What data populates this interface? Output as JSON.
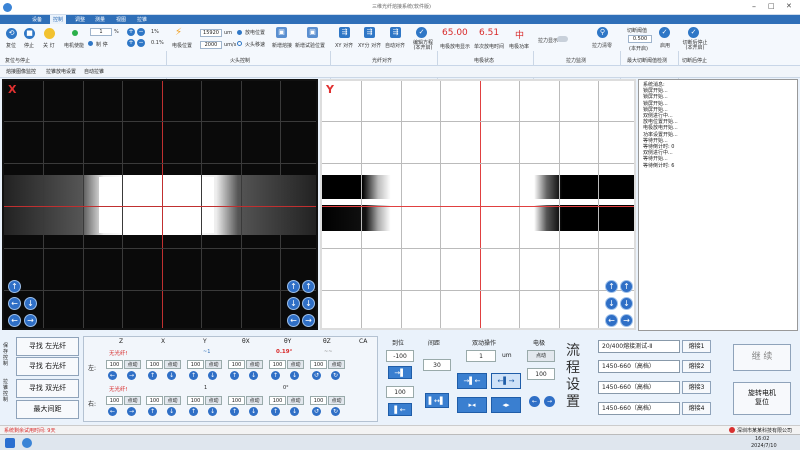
{
  "app": {
    "title": "三维光纤熔接系统(软件版)"
  },
  "menu": {
    "items": [
      "设备",
      "控制",
      "调整",
      "测量",
      "视图",
      "拉锥"
    ],
    "active_index": 1
  },
  "ribbon": {
    "reset_label": "复位",
    "stop_label": "停止",
    "on_label": "关 灯",
    "motor_label": "电机使能",
    "brake_label": "制 停",
    "step_value": "1",
    "step_unit": "%",
    "speed1": "1%",
    "speed2": "0.1%",
    "fire_pos_label": "电极位置",
    "motor_pos": "15920",
    "motor_unit1": "um",
    "fire_pos": "2000",
    "motor_unit2": "um/s",
    "electrode_pos_label": "放电位置",
    "fire_move_label": "火头移速",
    "new_fiber_label": "新增熔接",
    "new_trial_label": "新增试验位置",
    "group1": "复位与停止",
    "group2": "火头控制",
    "xy_align": "XY 对齐",
    "xy_focus": "XY分 对齐",
    "auto_align": "自动对齐",
    "edit_program": "编辑方程\n(本开启)",
    "group3": "光纤对齐",
    "param1": "65.00",
    "param2": "6.51",
    "param3": "中",
    "param1_label": "电极放电显示",
    "param2_label": "单次放电时间",
    "param3_label": "电极功率",
    "group4": "电极状态",
    "tension_label": "拉力显示",
    "tension_clear": "拉力清零",
    "group5": "拉力监测",
    "max_force_label": "切断阈值",
    "max_force_value": "0.500",
    "max_force_note": "(本开启)",
    "apply_label": "启用",
    "group6": "最大切断阈值检测",
    "stop_label2": "切断后停止\n(本开启)",
    "group7": "切断后停止"
  },
  "subtabs": [
    "熔接图像监控",
    "拉锥放电设置",
    "自动拉锥"
  ],
  "panels": {
    "left_label": "X",
    "right_label": "Y"
  },
  "log": {
    "title": "系统消息:",
    "lines": [
      "锁屏开始...",
      "锁屏开始...",
      "锁屏开始...",
      "锁屏开始...",
      "双侧进行中...",
      "放电位置开始...",
      "电极放电开始...",
      "功率设置开始...",
      "等待开始...",
      "等待倒计时: 0",
      "双侧进行中...",
      "等待开始...",
      "等待倒计时: 6"
    ]
  },
  "table": {
    "headers": [
      "Z",
      "X",
      "Y",
      "θX",
      "θY",
      "θZ",
      "CA"
    ],
    "left_row_label": "左:",
    "right_row_label": "右:",
    "left_values": [
      "无光纤!",
      "~1",
      "",
      "",
      "0.19°",
      "~~"
    ],
    "right_values": [
      "无光纤!",
      "1",
      "",
      "0°",
      "",
      ""
    ],
    "cell_value": "100",
    "dot_label": "点动"
  },
  "left_buttons": {
    "side_top": "保存控制",
    "side_bottom": "拉锥控制",
    "find_left": "寻找 左光纤",
    "find_right": "寻找 右光纤",
    "find_both": "寻找 双光纤",
    "max_gap": "最大间距"
  },
  "ops": {
    "align_header": "到位",
    "gap_header": "间距",
    "dual_header": "双动操作",
    "electrode_header": "电极",
    "align_value1": "-100",
    "align_value2": "100",
    "gap_value": "30",
    "dual_value": "1",
    "dual_unit": "um",
    "electrode_dot": "点动",
    "electrode_value": "100"
  },
  "process": {
    "label": "流程设置",
    "options": [
      "20/400熔接测试-Ⅱ",
      "1450-660（高档）",
      "1450-660（高档）",
      "1450-660（高档）"
    ],
    "step_buttons": [
      "熔接1",
      "熔接2",
      "熔接3",
      "熔接4"
    ],
    "continue": "继 续",
    "rotate_reset": "旋转电机\n复位"
  },
  "status": {
    "text": "系统剩余试用时间: 9天",
    "company": "深圳市某某科技有限公司"
  },
  "taskbar": {
    "time": "16:02",
    "date": "2024/7/10"
  },
  "colors": {
    "accent": "#2f6fb8",
    "alert": "#d82a2a"
  }
}
